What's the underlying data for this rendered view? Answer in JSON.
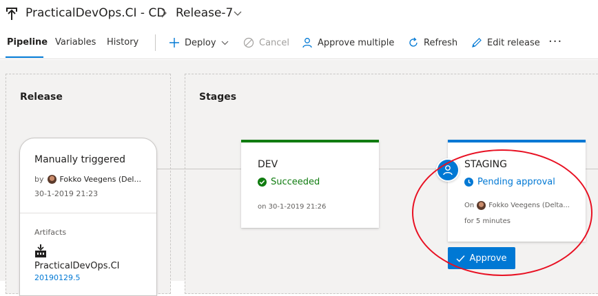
{
  "header": {
    "pipeline_name": "PracticalDevOps.CI - CD",
    "release_name": "Release-7"
  },
  "tabs": [
    {
      "label": "Pipeline",
      "active": true
    },
    {
      "label": "Variables",
      "active": false
    },
    {
      "label": "History",
      "active": false
    }
  ],
  "toolbar": {
    "deploy": "Deploy",
    "cancel": "Cancel",
    "approve_multiple": "Approve multiple",
    "refresh": "Refresh",
    "edit_release": "Edit release",
    "more": "···"
  },
  "release_panel": {
    "title": "Release",
    "trigger": "Manually triggered",
    "by_prefix": "by",
    "by_user": "Fokko Veegens (Del...",
    "date": "30-1-2019 21:23",
    "artifacts_label": "Artifacts",
    "artifact_name": "PracticalDevOps.CI",
    "artifact_version": "20190129.5"
  },
  "stages_panel": {
    "title": "Stages",
    "stages": [
      {
        "name": "DEV",
        "status": "Succeeded",
        "meta": "on 30-1-2019 21:26",
        "color": "#107c10"
      },
      {
        "name": "STAGING",
        "status": "Pending approval",
        "on_prefix": "On",
        "on_user": "Fokko Veegens (Delta...",
        "duration": "for 5 minutes",
        "color": "#0078d4"
      }
    ],
    "approve_button": "Approve"
  },
  "colors": {
    "accent": "#0078d4",
    "success": "#107c10",
    "highlight": "#e81123"
  }
}
